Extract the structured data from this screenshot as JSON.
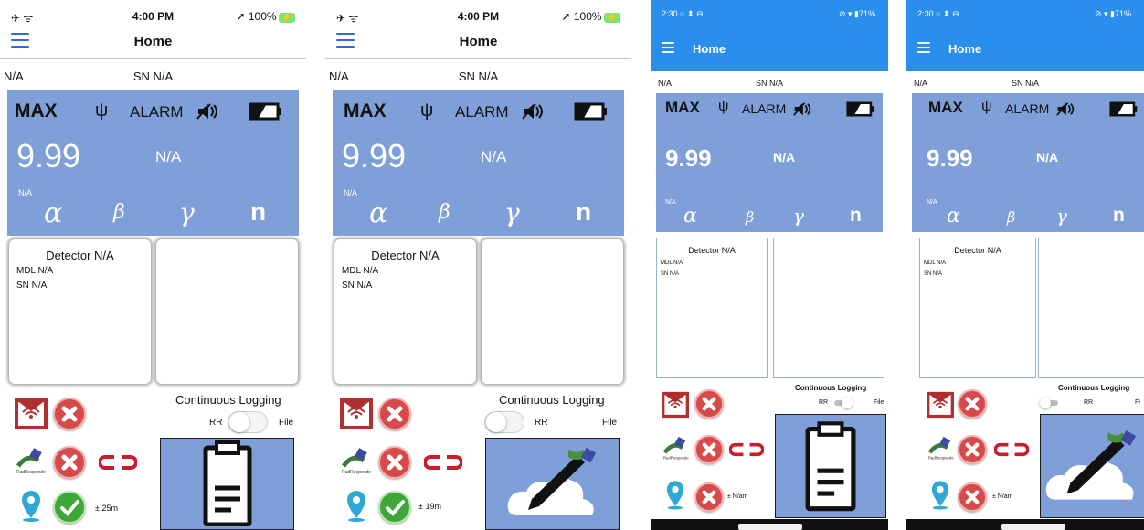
{
  "screens": [
    {
      "status": {
        "left": "✈ ᯤ",
        "time": "4:00 PM",
        "right": "➚ 100%",
        "battery_label": "⚡"
      },
      "title": "Home",
      "serial_left": "N/A",
      "serial_center": "SN N/A",
      "panel": {
        "max": "MAX",
        "usb": "ψ",
        "alarm": "ALARM",
        "reading": "9.99",
        "unit": "N/A",
        "small": "N/A",
        "alpha": "α",
        "beta": "β",
        "gamma": "γ",
        "neutron": "n"
      },
      "detector": {
        "title": "Detector N/A",
        "mdl": "MDL N/A",
        "sn": "SN N/A"
      },
      "logging": {
        "label": "Continuous Logging",
        "left": "RR",
        "right": "File"
      },
      "accuracy": "± 25m"
    },
    {
      "status": {
        "left": "✈ ᯤ",
        "time": "4:00 PM",
        "right": "➚ 100%",
        "battery_label": "⚡"
      },
      "title": "Home",
      "serial_left": "N/A",
      "serial_center": "SN N/A",
      "panel": {
        "max": "MAX",
        "usb": "ψ",
        "alarm": "ALARM",
        "reading": "9.99",
        "unit": "N/A",
        "small": "N/A",
        "alpha": "α",
        "beta": "β",
        "gamma": "γ",
        "neutron": "n"
      },
      "detector": {
        "title": "Detector N/A",
        "mdl": "MDL N/A",
        "sn": "SN N/A"
      },
      "logging": {
        "label": "Continuous Logging",
        "left": "RR",
        "right": "File"
      },
      "accuracy": "± 19m"
    },
    {
      "status": {
        "left": "2:30 ○ ⬍ ⊖",
        "right": "⊘ ▾ ▮71%"
      },
      "title": "Home",
      "serial_left": "N/A",
      "serial_center": "SN N/A",
      "panel": {
        "max": "MAX",
        "usb": "ψ",
        "alarm": "ALARM",
        "reading": "9.99",
        "unit": "N/A",
        "small": "N/A",
        "alpha": "α",
        "beta": "β",
        "gamma": "γ",
        "neutron": "n"
      },
      "detector": {
        "title": "Detector N/A",
        "mdl": "MDL N/A",
        "sn": "SN N/A"
      },
      "logging": {
        "label": "Continuous Logging",
        "left": "RR",
        "right": "File"
      },
      "accuracy": "± N/am"
    },
    {
      "status": {
        "left": "2:30 ○ ⬍ ⊖",
        "right": "⊘ ▾ ▮71%"
      },
      "title": "Home",
      "serial_left": "N/A",
      "serial_center": "SN N/A",
      "panel": {
        "max": "MAX",
        "usb": "ψ",
        "alarm": "ALARM",
        "reading": "9.99",
        "unit": "N/A",
        "small": "N/A",
        "alpha": "α",
        "beta": "β",
        "gamma": "γ",
        "neutron": "n"
      },
      "detector": {
        "title": "Detector N/A",
        "mdl": "MDL N/A",
        "sn": "SN N/A"
      },
      "logging": {
        "label": "Continuous Logging",
        "left": "RR",
        "right": "Fi"
      },
      "accuracy": "± N/am"
    }
  ],
  "colors": {
    "panel": "#7f9fd9",
    "android_bar": "#2a8eec",
    "ios_accent": "#2b6fd6",
    "error": "#d64a4a",
    "ok": "#3fa63a"
  },
  "icons": [
    "menu-icon",
    "usb-icon",
    "speaker-mute-icon",
    "battery-icon",
    "wifi-pin-icon",
    "error-icon",
    "link-icon",
    "satellite-icon",
    "location-pin-icon",
    "check-icon",
    "clipboard-icon",
    "cloud-pencil-icon"
  ]
}
